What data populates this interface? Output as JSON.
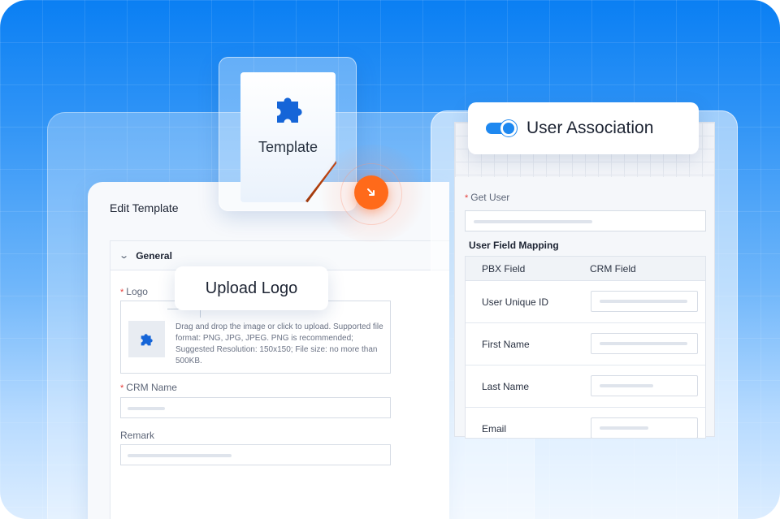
{
  "edit_panel": {
    "title": "Edit Template",
    "section": "General",
    "logo_label": "Logo",
    "upload_hint": "Drag and drop the image or click to upload. Supported file format: PNG, JPG, JPEG. PNG is recommended; Suggested Resolution: 150x150; File size: no more than 500KB.",
    "crm_name_label": "CRM Name",
    "remark_label": "Remark"
  },
  "template_card": {
    "label": "Template",
    "icon": "puzzle-icon"
  },
  "upload_callout": {
    "label": "Upload Logo"
  },
  "user_association": {
    "title": "User Association",
    "toggle_on": true,
    "get_user_label": "Get User",
    "mapping_title": "User Field Mapping",
    "columns": [
      "PBX Field",
      "CRM Field"
    ],
    "rows": [
      "User Unique ID",
      "First Name",
      "Last Name",
      "Email"
    ]
  },
  "colors": {
    "accent": "#1e88f0",
    "action": "#ff6a1a",
    "required": "#e53935"
  }
}
